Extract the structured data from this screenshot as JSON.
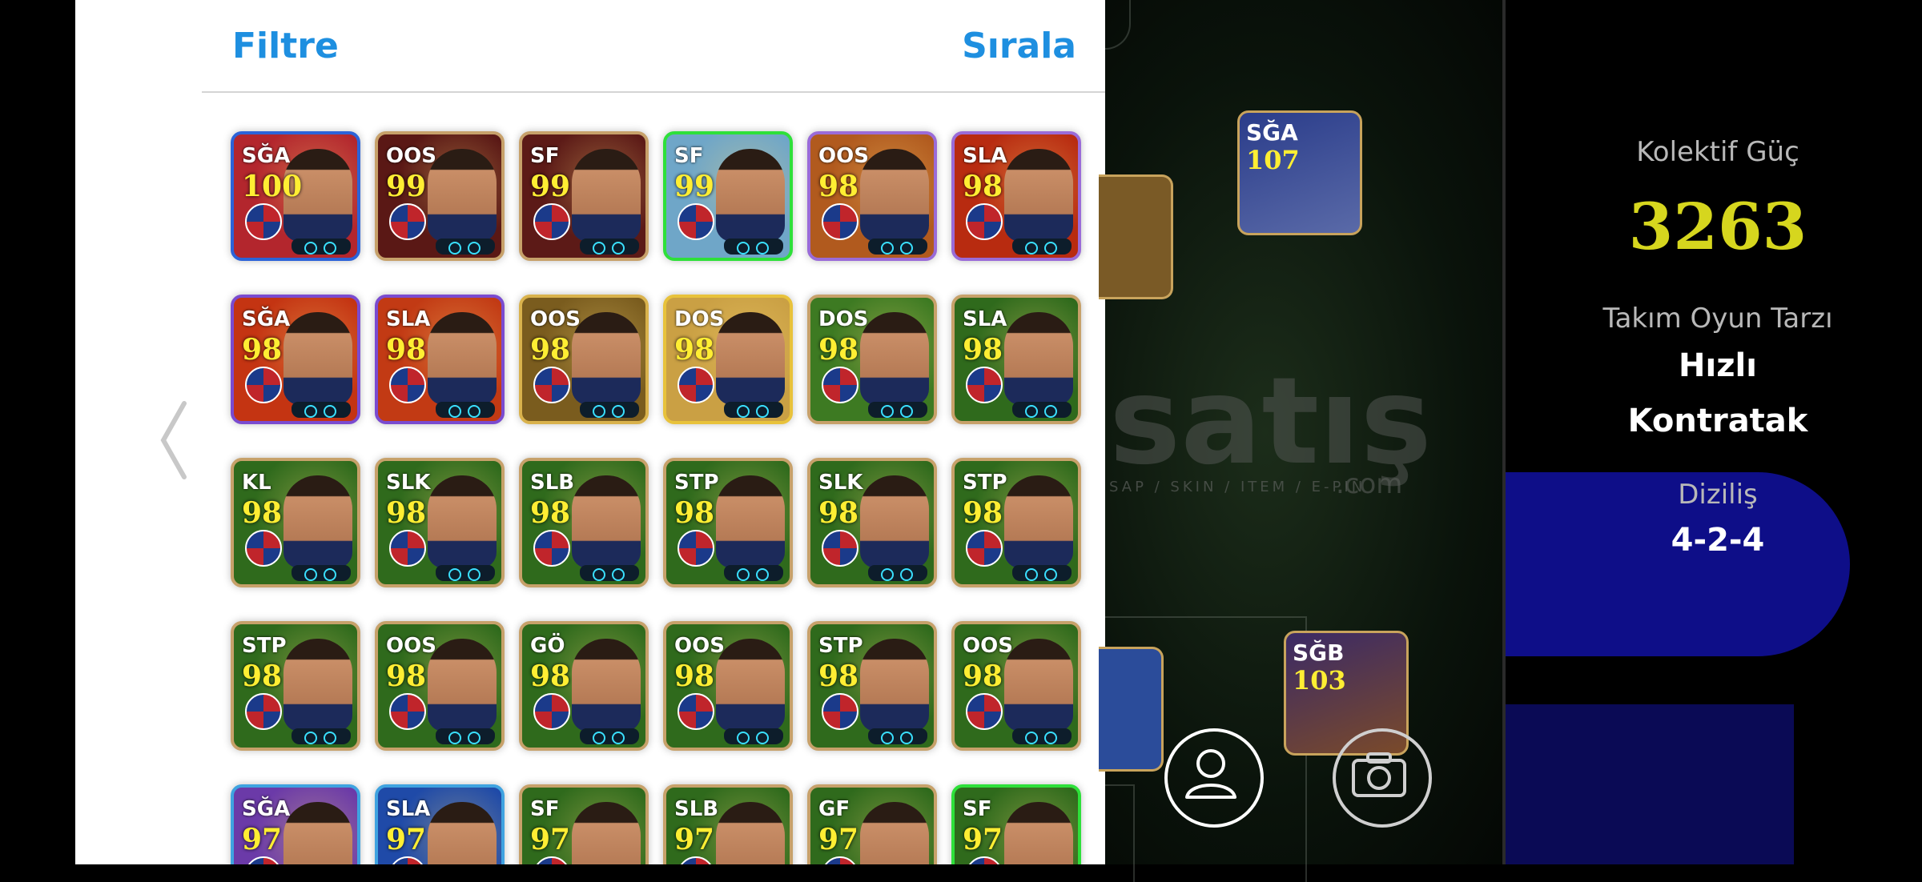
{
  "panel": {
    "filter_label": "Filtre",
    "sort_label": "Sırala"
  },
  "cards": [
    {
      "pos": "SĞA",
      "rating": "100",
      "frame": "#2c63d8",
      "bg": "#b3262d"
    },
    {
      "pos": "OOS",
      "rating": "99",
      "frame": "#c7a16a",
      "bg": "#5a1815"
    },
    {
      "pos": "SF",
      "rating": "99",
      "frame": "#c7a16a",
      "bg": "#5c1a17"
    },
    {
      "pos": "SF",
      "rating": "99",
      "frame": "#2ee03a",
      "bg": "#6fa6c8"
    },
    {
      "pos": "OOS",
      "rating": "98",
      "frame": "#9a6bd8",
      "bg": "#b15a1e"
    },
    {
      "pos": "SLA",
      "rating": "98",
      "frame": "#9a6bd8",
      "bg": "#b82b10"
    },
    {
      "pos": "SĞA",
      "rating": "98",
      "frame": "#7a4bd0",
      "bg": "#c43412"
    },
    {
      "pos": "SLA",
      "rating": "98",
      "frame": "#7a4bd0",
      "bg": "#c23a14"
    },
    {
      "pos": "OOS",
      "rating": "98",
      "frame": "#d9b24c",
      "bg": "#7a5c1e"
    },
    {
      "pos": "DOS",
      "rating": "98",
      "frame": "#e8c23b",
      "bg": "#caa044"
    },
    {
      "pos": "DOS",
      "rating": "98",
      "frame": "#c7a16a",
      "bg": "#3d7a22"
    },
    {
      "pos": "SLA",
      "rating": "98",
      "frame": "#c7a16a",
      "bg": "#2f6a1c"
    },
    {
      "pos": "KL",
      "rating": "98",
      "frame": "#c7a16a",
      "bg": "#2f6a1c"
    },
    {
      "pos": "SLK",
      "rating": "98",
      "frame": "#c7a16a",
      "bg": "#2f6a1c"
    },
    {
      "pos": "SLB",
      "rating": "98",
      "frame": "#c7a16a",
      "bg": "#2f6a1c"
    },
    {
      "pos": "STP",
      "rating": "98",
      "frame": "#c7a16a",
      "bg": "#2f6a1c"
    },
    {
      "pos": "SLK",
      "rating": "98",
      "frame": "#c7a16a",
      "bg": "#2f6a1c"
    },
    {
      "pos": "STP",
      "rating": "98",
      "frame": "#c7a16a",
      "bg": "#2f6a1c"
    },
    {
      "pos": "STP",
      "rating": "98",
      "frame": "#c7a16a",
      "bg": "#2f6a1c"
    },
    {
      "pos": "OOS",
      "rating": "98",
      "frame": "#c7a16a",
      "bg": "#2f6a1c"
    },
    {
      "pos": "GÖ",
      "rating": "98",
      "frame": "#c7a16a",
      "bg": "#2f6a1c"
    },
    {
      "pos": "OOS",
      "rating": "98",
      "frame": "#c7a16a",
      "bg": "#2f6a1c"
    },
    {
      "pos": "STP",
      "rating": "98",
      "frame": "#c7a16a",
      "bg": "#2f6a1c"
    },
    {
      "pos": "OOS",
      "rating": "98",
      "frame": "#c7a16a",
      "bg": "#2f6a1c"
    },
    {
      "pos": "SĞA",
      "rating": "97",
      "frame": "#3fa3e0",
      "bg": "#6b3aa8"
    },
    {
      "pos": "SLA",
      "rating": "97",
      "frame": "#3fa3e0",
      "bg": "#1f4aa8"
    },
    {
      "pos": "SF",
      "rating": "97",
      "frame": "#c7a16a",
      "bg": "#2f6a1c"
    },
    {
      "pos": "SLB",
      "rating": "97",
      "frame": "#c7a16a",
      "bg": "#2f6a1c"
    },
    {
      "pos": "GF",
      "rating": "97",
      "frame": "#c7a16a",
      "bg": "#2f6a1c"
    },
    {
      "pos": "SF",
      "rating": "97",
      "frame": "#2ee03a",
      "bg": "#2f6a1c"
    }
  ],
  "field": {
    "watermark": "satış",
    "watermark_sub": "SAP / SKIN / ITEM / E-PIN",
    "watermark_dotcom": ".com",
    "players": [
      {
        "pos": "SĞA",
        "rating": "107"
      },
      {
        "pos": "SĞB",
        "rating": "103"
      }
    ]
  },
  "stats": {
    "power_label": "Kolektif Güç",
    "power_value": "3263",
    "style_label": "Takım Oyun Tarzı",
    "style_value_1": "Hızlı",
    "style_value_2": "Kontratak",
    "formation_label": "Diziliş",
    "formation_value": "4-2-4"
  },
  "icons": [
    "chevron-left-icon",
    "profile-icon",
    "camera-icon"
  ]
}
